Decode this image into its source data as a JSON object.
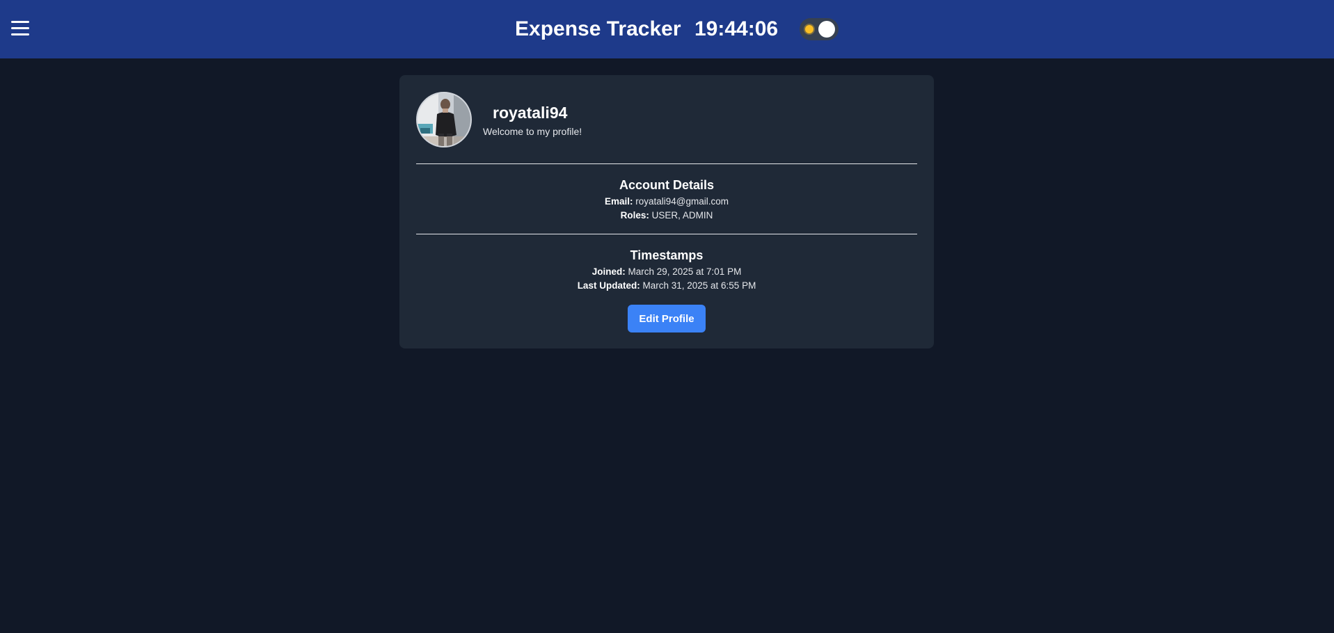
{
  "header": {
    "title": "Expense Tracker",
    "clock": "19:44:06",
    "menu_icon": "hamburger-menu-icon",
    "theme_toggle_icon": "sun-icon",
    "background_color": "#1e3a8a"
  },
  "profile": {
    "username": "royatali94",
    "tagline": "Welcome to my profile!",
    "avatar_icon": "user-avatar"
  },
  "account_details": {
    "title": "Account Details",
    "email_label": "Email:",
    "email_value": "royatali94@gmail.com",
    "roles_label": "Roles:",
    "roles_value": "USER, ADMIN"
  },
  "timestamps": {
    "title": "Timestamps",
    "joined_label": "Joined:",
    "joined_value": "March 29, 2025 at 7:01 PM",
    "updated_label": "Last Updated:",
    "updated_value": "March 31, 2025 at 6:55 PM"
  },
  "actions": {
    "edit_label": "Edit Profile",
    "button_color": "#3b82f6"
  },
  "colors": {
    "page_background": "#111827",
    "card_background": "#1f2937"
  }
}
